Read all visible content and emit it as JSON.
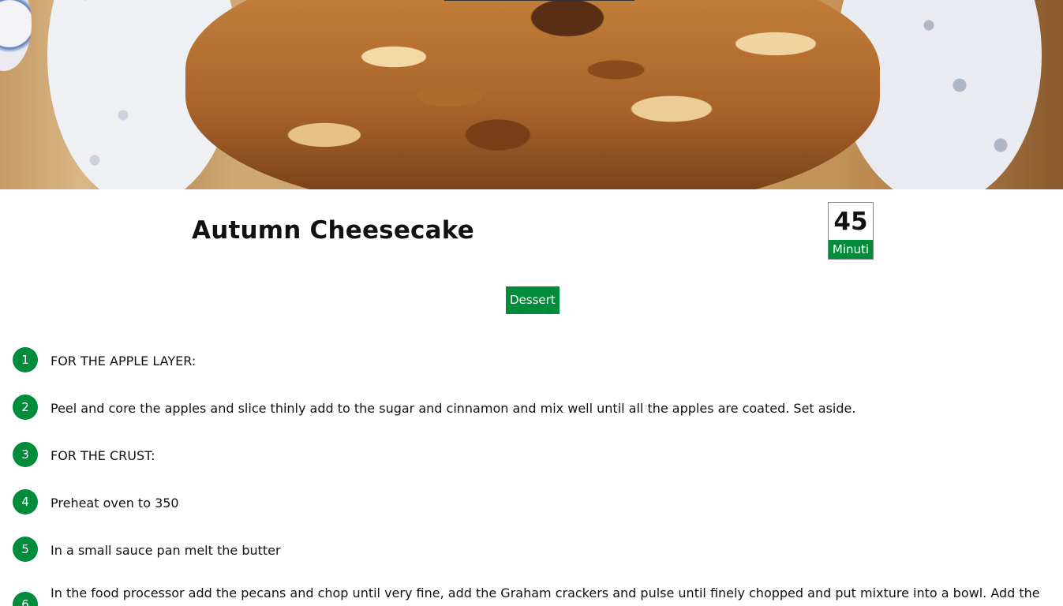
{
  "recipe": {
    "title": "Autumn Cheesecake",
    "time_value": "45",
    "time_unit": "Minuti",
    "category": "Dessert",
    "hero_image": "cheesecake-photo"
  },
  "steps": [
    {
      "number": "1",
      "text": "FOR THE APPLE LAYER:"
    },
    {
      "number": "2",
      "text": "Peel and core the apples and slice thinly add to the sugar and cinnamon and mix well until all the apples are coated. Set aside."
    },
    {
      "number": "3",
      "text": "FOR THE CRUST:"
    },
    {
      "number": "4",
      "text": "Preheat oven to 350"
    },
    {
      "number": "5",
      "text": "In a small sauce pan melt the butter"
    },
    {
      "number": "6",
      "text": "In the food processor add the pecans and chop until very fine, add the Graham crackers and pulse until finely chopped and put mixture into a bowl. Add the"
    }
  ],
  "colors": {
    "accent": "#008c3a",
    "text": "#111111",
    "background": "#ffffff"
  }
}
